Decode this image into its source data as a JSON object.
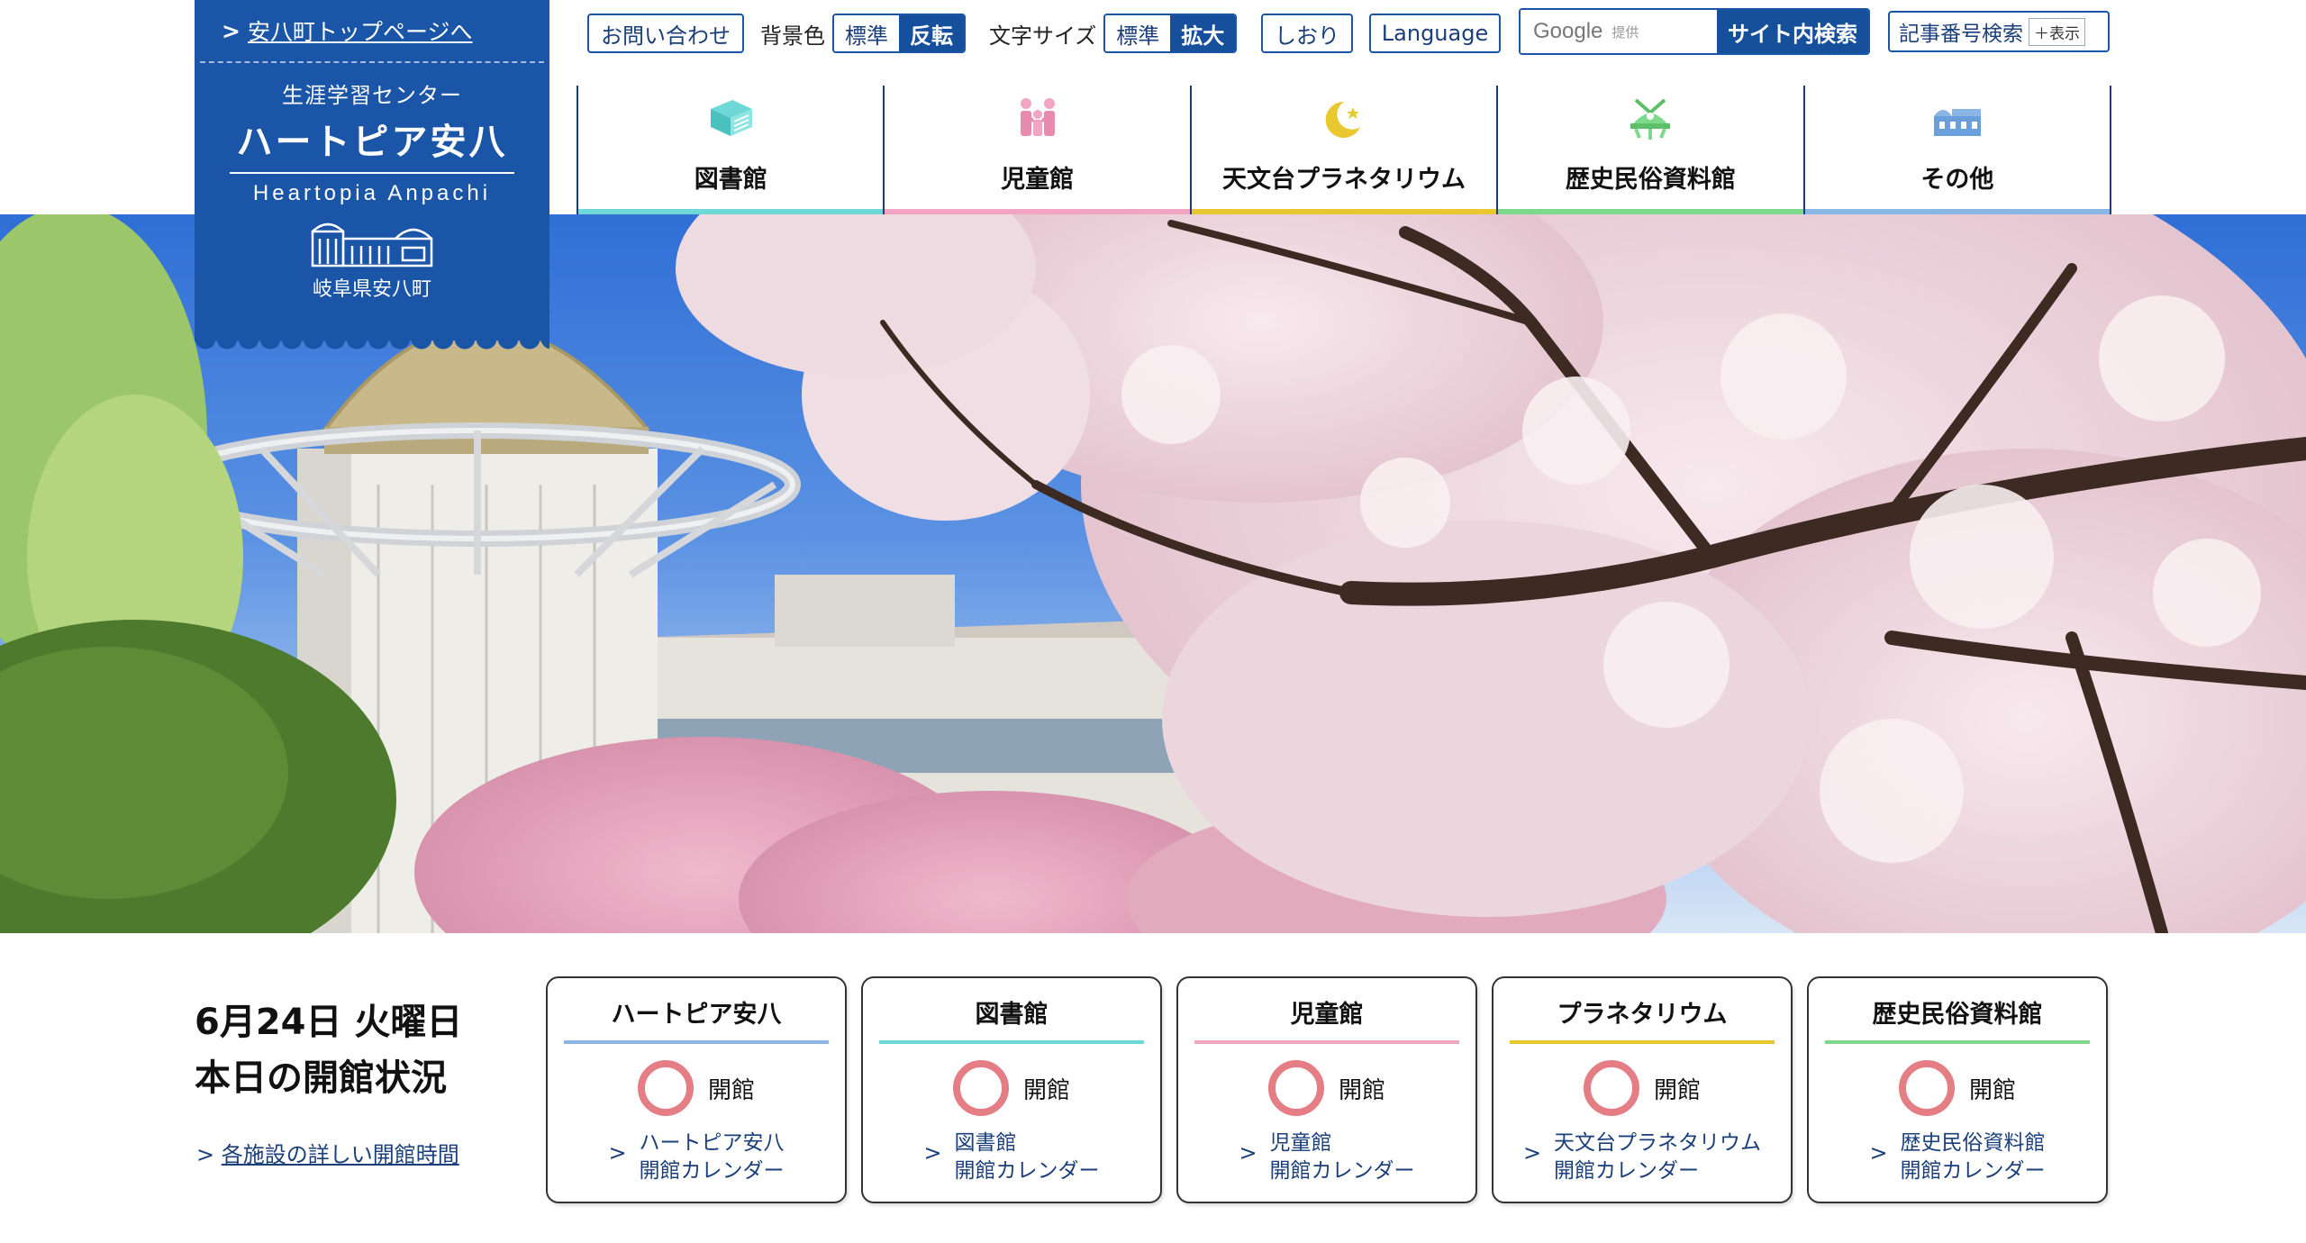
{
  "logo": {
    "top_link": "安八町トップページへ",
    "subtitle": "生涯学習センター",
    "title": "ハートピア安八",
    "english": "Heartopia Anpachi",
    "prefecture": "岐阜県安八町"
  },
  "utility": {
    "contact": "お問い合わせ",
    "bg_label": "背景色",
    "bg_standard": "標準",
    "bg_invert": "反転",
    "fontsize_label": "文字サイズ",
    "fontsize_standard": "標準",
    "fontsize_large": "拡大",
    "bookmark": "しおり",
    "language": "Language",
    "search_brand": "Google",
    "search_provided": "提供",
    "search_button": "サイト内検索",
    "article_search": "記事番号検索",
    "article_show": "＋表示"
  },
  "nav": [
    {
      "label": "図書館",
      "icon": "book-icon",
      "color": "#6ed8d6"
    },
    {
      "label": "児童館",
      "icon": "children-icon",
      "color": "#f2a5c2"
    },
    {
      "label": "天文台プラネタリウム",
      "icon": "moon-star-icon",
      "color": "#e8c82e"
    },
    {
      "label": "歴史民俗資料館",
      "icon": "helmet-icon",
      "color": "#7fd98a"
    },
    {
      "label": "その他",
      "icon": "building-icon",
      "color": "#8ab6e6"
    }
  ],
  "status": {
    "date": "6月24日 火曜日",
    "heading": "本日の開館状況",
    "details_link": "各施設の詳しい開館時間"
  },
  "cards": [
    {
      "title": "ハートピア安八",
      "status": "開館",
      "link_line1": "ハートピア安八",
      "link_line2": "開館カレンダー",
      "color": "#8ab6e6"
    },
    {
      "title": "図書館",
      "status": "開館",
      "link_line1": "図書館",
      "link_line2": "開館カレンダー",
      "color": "#6ed8d6"
    },
    {
      "title": "児童館",
      "status": "開館",
      "link_line1": "児童館",
      "link_line2": "開館カレンダー",
      "color": "#f2a5c2"
    },
    {
      "title": "プラネタリウム",
      "status": "開館",
      "link_line1": "天文台プラネタリウム",
      "link_line2": "開館カレンダー",
      "color": "#e8c82e"
    },
    {
      "title": "歴史民俗資料館",
      "status": "開館",
      "link_line1": "歴史民俗資料館",
      "link_line2": "開館カレンダー",
      "color": "#7fd98a"
    }
  ],
  "colors": {
    "brand": "#1a55a8",
    "status_open_ring": "#e57d84"
  }
}
